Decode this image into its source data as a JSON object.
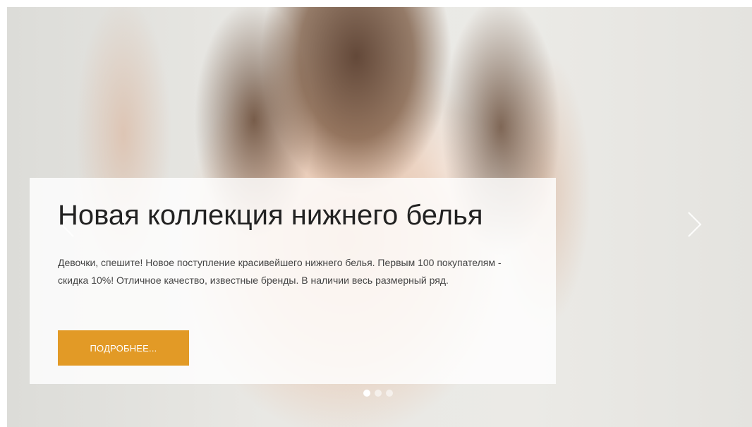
{
  "slider": {
    "slide": {
      "title": "Новая коллекция нижнего белья",
      "text": "Девочки, спешите! Новое поступление красивейшего нижнего белья. Первым 100 покупателям - скидка 10%! Отличное качество, известные бренды. В наличии весь размерный ряд.",
      "button_label": "ПОДРОБНЕЕ..."
    },
    "arrows": {
      "prev_icon": "chevron-left-icon",
      "next_icon": "chevron-right-icon"
    },
    "pagination": {
      "total": 3,
      "active_index": 0
    },
    "colors": {
      "accent": "#e29a26",
      "caption_bg": "#ffffff",
      "title": "#222222",
      "text": "#444444"
    }
  }
}
